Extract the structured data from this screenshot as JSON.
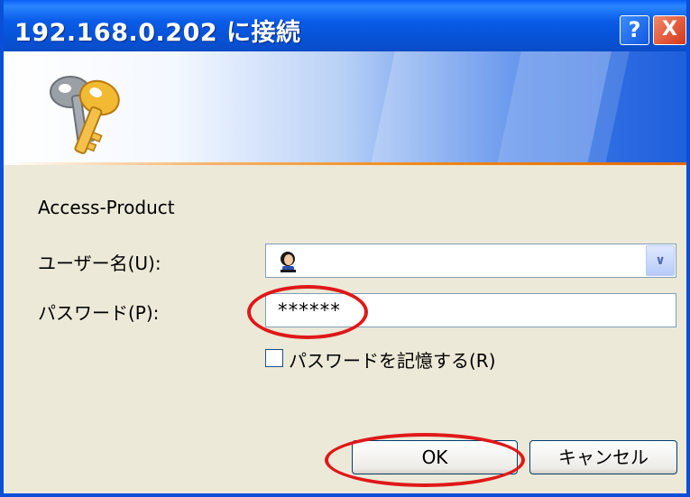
{
  "window": {
    "title": "192.168.0.202 に接続",
    "help_label": "?",
    "close_label": "X"
  },
  "colors": {
    "titlebar": "#0a5ce8",
    "dialog_bg": "#ece9d8",
    "annotation": "#e01818",
    "banner_accent": "#f08a1a"
  },
  "banner": {
    "icon": "keys-icon"
  },
  "dialog": {
    "realm": "Access-Product",
    "username_label": "ユーザー名(U):",
    "username_value": "",
    "username_icon": "user-icon",
    "password_label": "パスワード(P):",
    "password_value": "******",
    "remember_label": "パスワードを記憶する(R)",
    "remember_checked": false
  },
  "buttons": {
    "ok": "OK",
    "cancel": "キャンセル"
  },
  "annotations": [
    {
      "target": "password-field"
    },
    {
      "target": "ok-button"
    }
  ]
}
